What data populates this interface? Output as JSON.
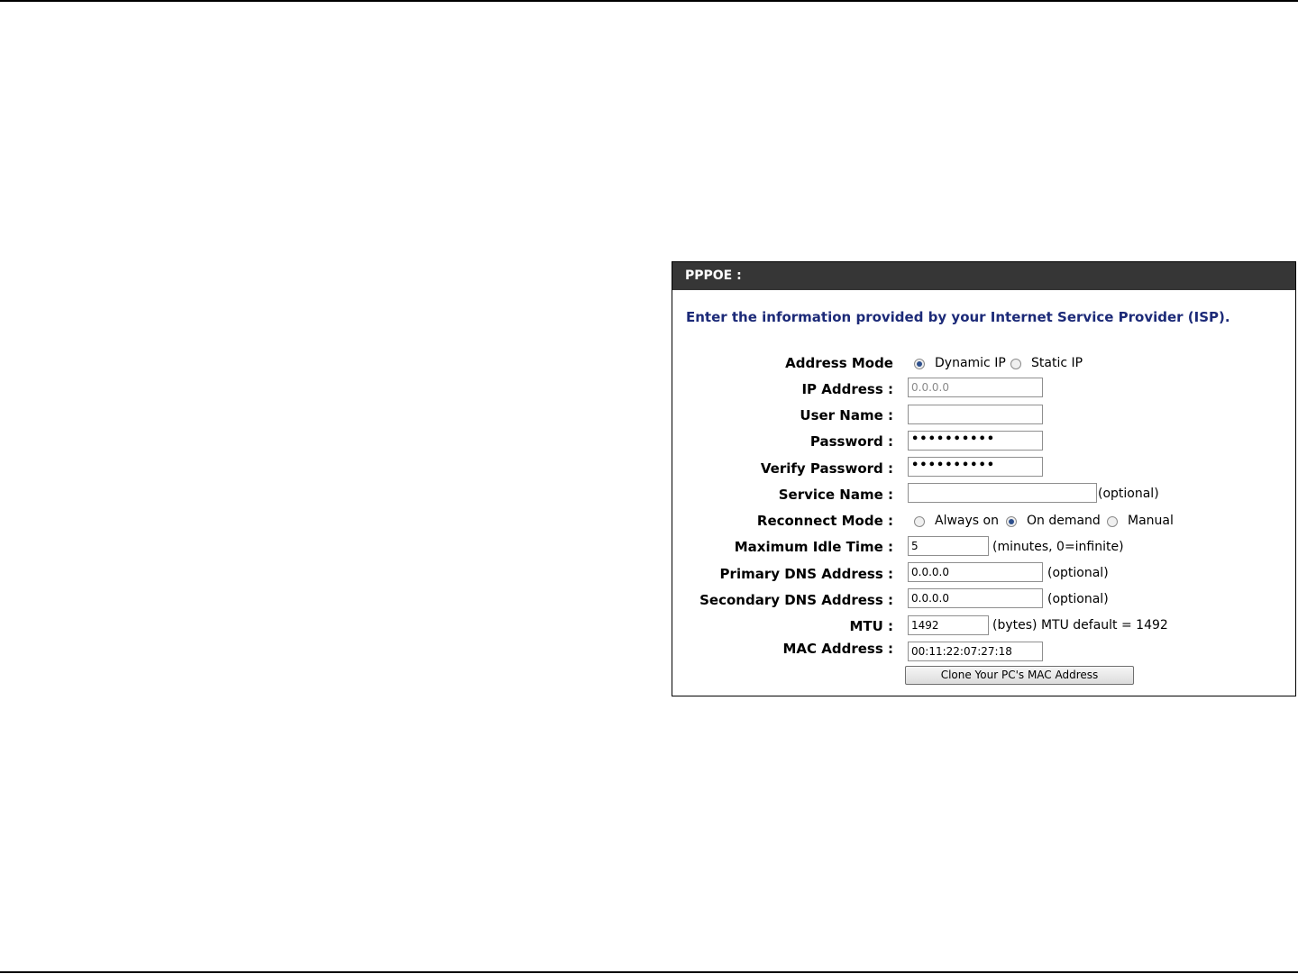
{
  "panel": {
    "title": "PPPOE :",
    "intro": "Enter the information provided by your Internet Service Provider (ISP)."
  },
  "address_mode": {
    "label": "Address Mode",
    "options": [
      {
        "label": "Dynamic IP",
        "selected": true
      },
      {
        "label": "Static IP",
        "selected": false
      }
    ]
  },
  "ip_address": {
    "label": "IP Address :",
    "value": "0.0.0.0"
  },
  "user_name": {
    "label": "User Name :",
    "value": ""
  },
  "password": {
    "label": "Password :",
    "value": "••••••••••"
  },
  "verify_password": {
    "label": "Verify Password :",
    "value": "••••••••••"
  },
  "service_name": {
    "label": "Service Name :",
    "value": "",
    "note": "(optional)"
  },
  "reconnect_mode": {
    "label": "Reconnect Mode :",
    "options": [
      {
        "label": "Always on",
        "selected": false
      },
      {
        "label": "On demand",
        "selected": true
      },
      {
        "label": "Manual",
        "selected": false
      }
    ]
  },
  "max_idle": {
    "label": "Maximum Idle Time :",
    "value": "5",
    "note": "(minutes, 0=infinite)"
  },
  "primary_dns": {
    "label": "Primary DNS Address :",
    "value": "0.0.0.0",
    "note": "(optional)"
  },
  "secondary_dns": {
    "label": "Secondary DNS Address :",
    "value": "0.0.0.0",
    "note": "(optional)"
  },
  "mtu": {
    "label": "MTU :",
    "value": "1492",
    "note": "(bytes) MTU default = 1492"
  },
  "mac_address": {
    "label": "MAC Address :",
    "value": "00:11:22:07:27:18"
  },
  "clone_button": {
    "label": "Clone Your PC's MAC Address"
  },
  "colors": {
    "header_bg": "#363636",
    "intro_text": "#1c2a78",
    "radio_selected": "#2d4f8c"
  }
}
